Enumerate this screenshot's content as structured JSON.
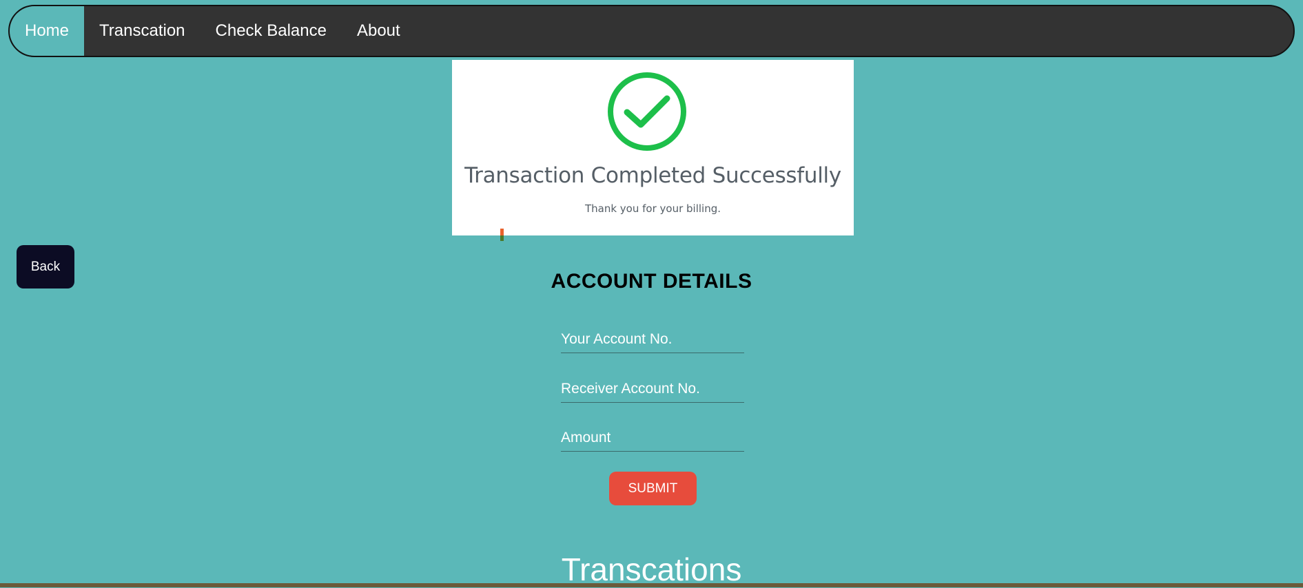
{
  "nav": {
    "items": [
      {
        "label": "Home",
        "active": true
      },
      {
        "label": "Transcation",
        "active": false
      },
      {
        "label": "Check Balance",
        "active": false
      },
      {
        "label": "About",
        "active": false
      }
    ]
  },
  "success": {
    "icon": "check-circle-icon",
    "icon_color": "#1dbf4a",
    "title": "Transaction Completed Successfully",
    "subtitle": "Thank you for your billing."
  },
  "back_button": {
    "label": "Back"
  },
  "form": {
    "heading": "ACCOUNT DETAILS",
    "your_account_placeholder": "Your Account No.",
    "receiver_account_placeholder": "Receiver Account No.",
    "amount_placeholder": "Amount",
    "submit_label": "SUBMIT"
  },
  "transactions": {
    "heading": "Transcations"
  },
  "colors": {
    "page_bg": "#5bb8b8",
    "nav_bg": "#333333",
    "back_bg": "#0c0c24",
    "submit_bg": "#e74c3c"
  }
}
